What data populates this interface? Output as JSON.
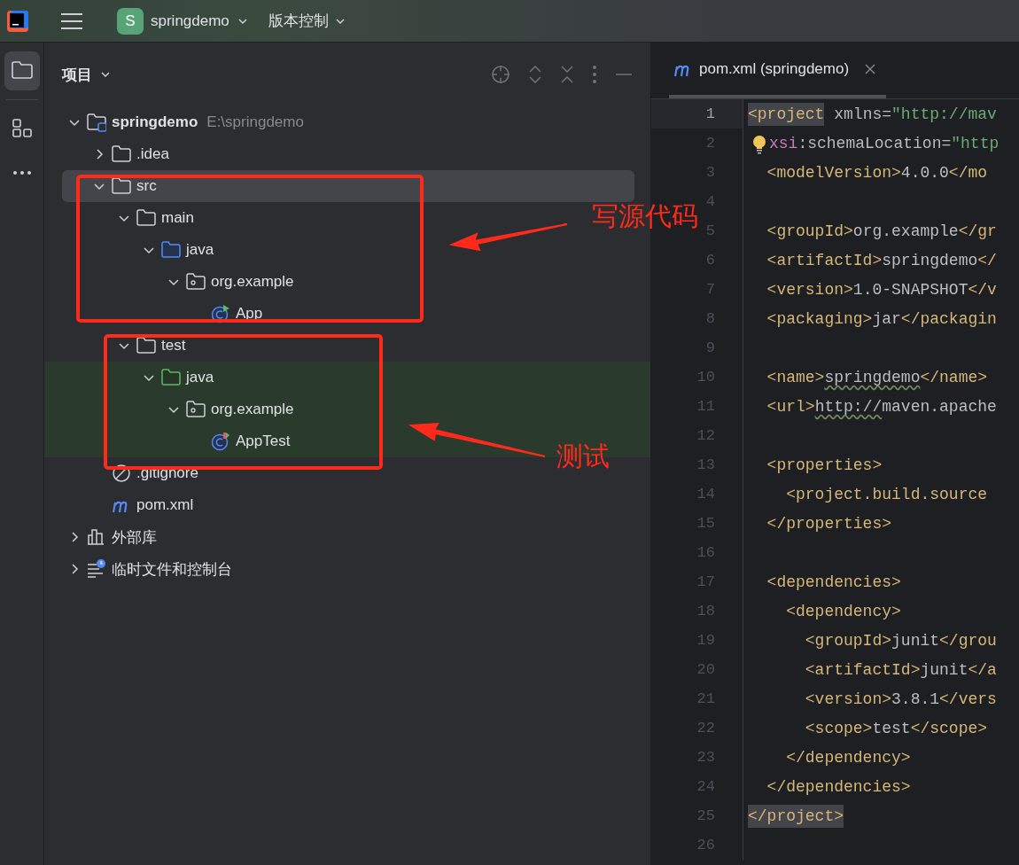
{
  "top_bar": {
    "project_badge": "S",
    "project": "springdemo",
    "vcs": "版本控制"
  },
  "tool_strip": [
    {
      "kind": "project",
      "selected": true
    },
    {
      "kind": "structure",
      "selected": false
    },
    {
      "kind": "more",
      "selected": false
    }
  ],
  "project_panel": {
    "title": "项目",
    "tree": [
      {
        "label": "springdemo",
        "path": "E:\\springdemo",
        "kind": "module",
        "expanded": true,
        "selected": false,
        "highlighted": false,
        "children": [
          {
            "label": ".idea",
            "kind": "folder",
            "expanded": false,
            "selected": false,
            "highlighted": false
          },
          {
            "label": "src",
            "kind": "folder",
            "expanded": true,
            "selected": true,
            "highlighted": false,
            "children": [
              {
                "label": "main",
                "kind": "folder",
                "expanded": true,
                "selected": false,
                "highlighted": false,
                "children": [
                  {
                    "label": "java",
                    "kind": "source-folder",
                    "expanded": true,
                    "selected": false,
                    "highlighted": false,
                    "children": [
                      {
                        "label": "org.example",
                        "kind": "package",
                        "expanded": true,
                        "selected": false,
                        "highlighted": false,
                        "children": [
                          {
                            "label": "App",
                            "kind": "class",
                            "selected": false,
                            "highlighted": false
                          }
                        ]
                      }
                    ]
                  }
                ]
              },
              {
                "label": "test",
                "kind": "folder",
                "expanded": true,
                "selected": false,
                "highlighted": false,
                "children": [
                  {
                    "label": "java",
                    "kind": "test-folder",
                    "expanded": true,
                    "selected": false,
                    "highlighted": true,
                    "children": [
                      {
                        "label": "org.example",
                        "kind": "package",
                        "expanded": true,
                        "selected": false,
                        "highlighted": true,
                        "children": [
                          {
                            "label": "AppTest",
                            "kind": "test-class",
                            "selected": false,
                            "highlighted": true
                          }
                        ]
                      }
                    ]
                  }
                ]
              }
            ]
          },
          {
            "label": ".gitignore",
            "kind": "ignore",
            "selected": false,
            "highlighted": false
          },
          {
            "label": "pom.xml",
            "kind": "maven",
            "selected": false,
            "highlighted": false
          }
        ]
      },
      {
        "label": "外部库",
        "kind": "library",
        "expanded": false,
        "selected": false,
        "highlighted": false
      },
      {
        "label": "临时文件和控制台",
        "kind": "scratch",
        "expanded": false,
        "selected": false,
        "highlighted": false
      }
    ]
  },
  "editor": {
    "tab": "pom.xml (springdemo)",
    "lines": [
      {
        "number": "1",
        "current": true,
        "bulb": false,
        "tokens": [
          {
            "kind": "tag-match",
            "text": "<project"
          },
          {
            "kind": "attr",
            "text": " xmlns="
          },
          {
            "kind": "string",
            "text": "\"http://mav"
          }
        ]
      },
      {
        "number": "2",
        "current": false,
        "bulb": true,
        "tokens": [
          {
            "kind": "ns",
            "text": "xsi"
          },
          {
            "kind": "attr",
            "text": ":schemaLocation="
          },
          {
            "kind": "string",
            "text": "\"http"
          }
        ]
      },
      {
        "number": "3",
        "current": false,
        "bulb": false,
        "tokens": [
          {
            "kind": "tag",
            "text": "  <modelVersion>"
          },
          {
            "kind": "text",
            "text": "4.0.0"
          },
          {
            "kind": "tag",
            "text": "</mo"
          }
        ]
      },
      {
        "number": "4",
        "current": false,
        "bulb": false
      },
      {
        "number": "5",
        "current": false,
        "bulb": false,
        "tokens": [
          {
            "kind": "tag",
            "text": "  <groupId>"
          },
          {
            "kind": "text",
            "text": "org.example"
          },
          {
            "kind": "tag",
            "text": "</gr"
          }
        ]
      },
      {
        "number": "6",
        "current": false,
        "bulb": false,
        "tokens": [
          {
            "kind": "tag",
            "text": "  <artifactId>"
          },
          {
            "kind": "text",
            "text": "springdemo"
          },
          {
            "kind": "tag",
            "text": "</"
          }
        ]
      },
      {
        "number": "7",
        "current": false,
        "bulb": false,
        "tokens": [
          {
            "kind": "tag",
            "text": "  <version>"
          },
          {
            "kind": "text",
            "text": "1.0-SNAPSHOT"
          },
          {
            "kind": "tag",
            "text": "</v"
          }
        ]
      },
      {
        "number": "8",
        "current": false,
        "bulb": false,
        "tokens": [
          {
            "kind": "tag",
            "text": "  <packaging>"
          },
          {
            "kind": "text",
            "text": "jar"
          },
          {
            "kind": "tag",
            "text": "</packagin"
          }
        ]
      },
      {
        "number": "9",
        "current": false,
        "bulb": false
      },
      {
        "number": "10",
        "current": false,
        "bulb": false,
        "tokens": [
          {
            "kind": "tag",
            "text": "  <name>"
          },
          {
            "kind": "text-typo",
            "text": "springdemo"
          },
          {
            "kind": "tag",
            "text": "</name>"
          }
        ]
      },
      {
        "number": "11",
        "current": false,
        "bulb": false,
        "tokens": [
          {
            "kind": "tag",
            "text": "  <url>"
          },
          {
            "kind": "text-typo",
            "text": "http://"
          },
          {
            "kind": "text",
            "text": "maven.apache"
          }
        ]
      },
      {
        "number": "12",
        "current": false,
        "bulb": false
      },
      {
        "number": "13",
        "current": false,
        "bulb": false,
        "tokens": [
          {
            "kind": "tag",
            "text": "  <properties>"
          }
        ]
      },
      {
        "number": "14",
        "current": false,
        "bulb": false,
        "tokens": [
          {
            "kind": "tag",
            "text": "    <project.build.source"
          }
        ]
      },
      {
        "number": "15",
        "current": false,
        "bulb": false,
        "tokens": [
          {
            "kind": "tag",
            "text": "  </properties>"
          }
        ]
      },
      {
        "number": "16",
        "current": false,
        "bulb": false
      },
      {
        "number": "17",
        "current": false,
        "bulb": false,
        "tokens": [
          {
            "kind": "tag",
            "text": "  <dependencies>"
          }
        ]
      },
      {
        "number": "18",
        "current": false,
        "bulb": false,
        "tokens": [
          {
            "kind": "tag",
            "text": "    <dependency>"
          }
        ]
      },
      {
        "number": "19",
        "current": false,
        "bulb": false,
        "tokens": [
          {
            "kind": "tag",
            "text": "      <groupId>"
          },
          {
            "kind": "text",
            "text": "junit"
          },
          {
            "kind": "tag",
            "text": "</grou"
          }
        ]
      },
      {
        "number": "20",
        "current": false,
        "bulb": false,
        "tokens": [
          {
            "kind": "tag",
            "text": "      <artifactId>"
          },
          {
            "kind": "text",
            "text": "junit"
          },
          {
            "kind": "tag",
            "text": "</a"
          }
        ]
      },
      {
        "number": "21",
        "current": false,
        "bulb": false,
        "tokens": [
          {
            "kind": "tag",
            "text": "      <version>"
          },
          {
            "kind": "text",
            "text": "3.8.1"
          },
          {
            "kind": "tag",
            "text": "</vers"
          }
        ]
      },
      {
        "number": "22",
        "current": false,
        "bulb": false,
        "tokens": [
          {
            "kind": "tag",
            "text": "      <scope>"
          },
          {
            "kind": "text",
            "text": "test"
          },
          {
            "kind": "tag",
            "text": "</scope>"
          }
        ]
      },
      {
        "number": "23",
        "current": false,
        "bulb": false,
        "tokens": [
          {
            "kind": "tag",
            "text": "    </dependency>"
          }
        ]
      },
      {
        "number": "24",
        "current": false,
        "bulb": false,
        "tokens": [
          {
            "kind": "tag",
            "text": "  </dependencies>"
          }
        ]
      },
      {
        "number": "25",
        "current": false,
        "bulb": false,
        "tokens": [
          {
            "kind": "tag-match",
            "text": "</project>"
          }
        ]
      },
      {
        "number": "26",
        "current": false,
        "bulb": false
      }
    ]
  },
  "annotations": [
    {
      "text": "写源代码"
    },
    {
      "text": "测试"
    }
  ]
}
